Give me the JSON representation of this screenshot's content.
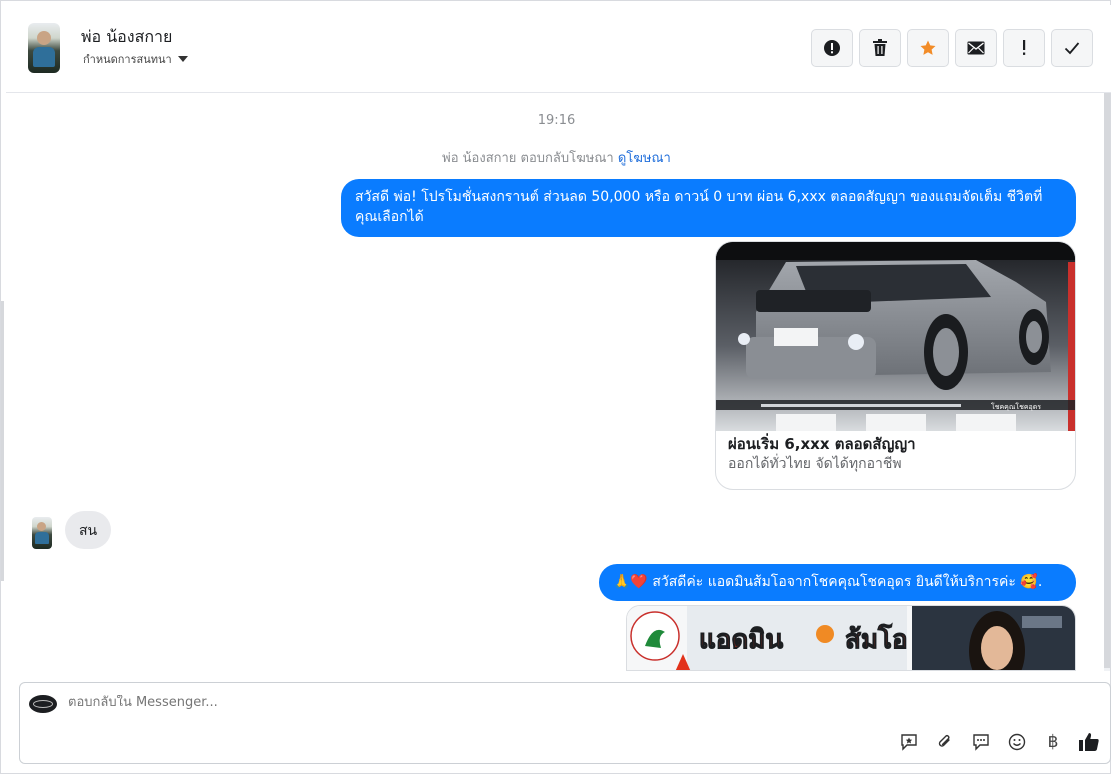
{
  "header": {
    "contact_name": "พ่อ น้องสกาย",
    "subtitle": "กำหนดการสนทนา",
    "toolbar": [
      {
        "name": "report-icon",
        "glyph": "!"
      },
      {
        "name": "trash-icon",
        "glyph": ""
      },
      {
        "name": "star-icon",
        "glyph": "★"
      },
      {
        "name": "mail-icon",
        "glyph": ""
      },
      {
        "name": "important-icon",
        "glyph": "!"
      },
      {
        "name": "check-icon",
        "glyph": "✓"
      }
    ]
  },
  "conversation": {
    "timestamp": "19:16",
    "ad_reply_note": "พ่อ น้องสกาย ตอบกลับโฆษณา",
    "ad_link": "ดูโฆษณา",
    "messages": {
      "outgoing_1": "สวัสดี พ่อ! โปรโมชั่นสงกรานต์ ส่วนลด 50,000 หรือ ดาวน์ 0 บาท ผ่อน 6,xxx ตลอดสัญญา ของแถมจัดเต็ม ชีวิตที่คุณเลือกได้",
      "card_title": "ผ่อนเริ่ม 6,xxx ตลอดสัญญา",
      "card_subtitle": "ออกได้ทั่วไทย จัดได้ทุกอาชีพ",
      "card_image_caption": "โชคคุณโชคอุดร",
      "incoming_1": "สน",
      "outgoing_2_emoji": "🙏❤️",
      "outgoing_2": "สวัสดีค่ะ แอดมินส้มโอจากโชคคุณโชคอุดร ยินดีให้บริการค่ะ 🥰.",
      "card2_text_a": "แอดมิน",
      "card2_text_b": "ส้มโอ"
    }
  },
  "composer": {
    "placeholder": "ตอบกลับใน Messenger...",
    "tools": [
      "saved-reply-icon",
      "attachment-icon",
      "speech-icon",
      "emoji-icon",
      "baht-icon",
      "like-icon"
    ],
    "baht_glyph": "฿"
  },
  "colors": {
    "outgoing_bubble": "#0a7cff",
    "incoming_bubble": "#e9eaed",
    "star": "#f28c28",
    "link": "#216fdb"
  }
}
